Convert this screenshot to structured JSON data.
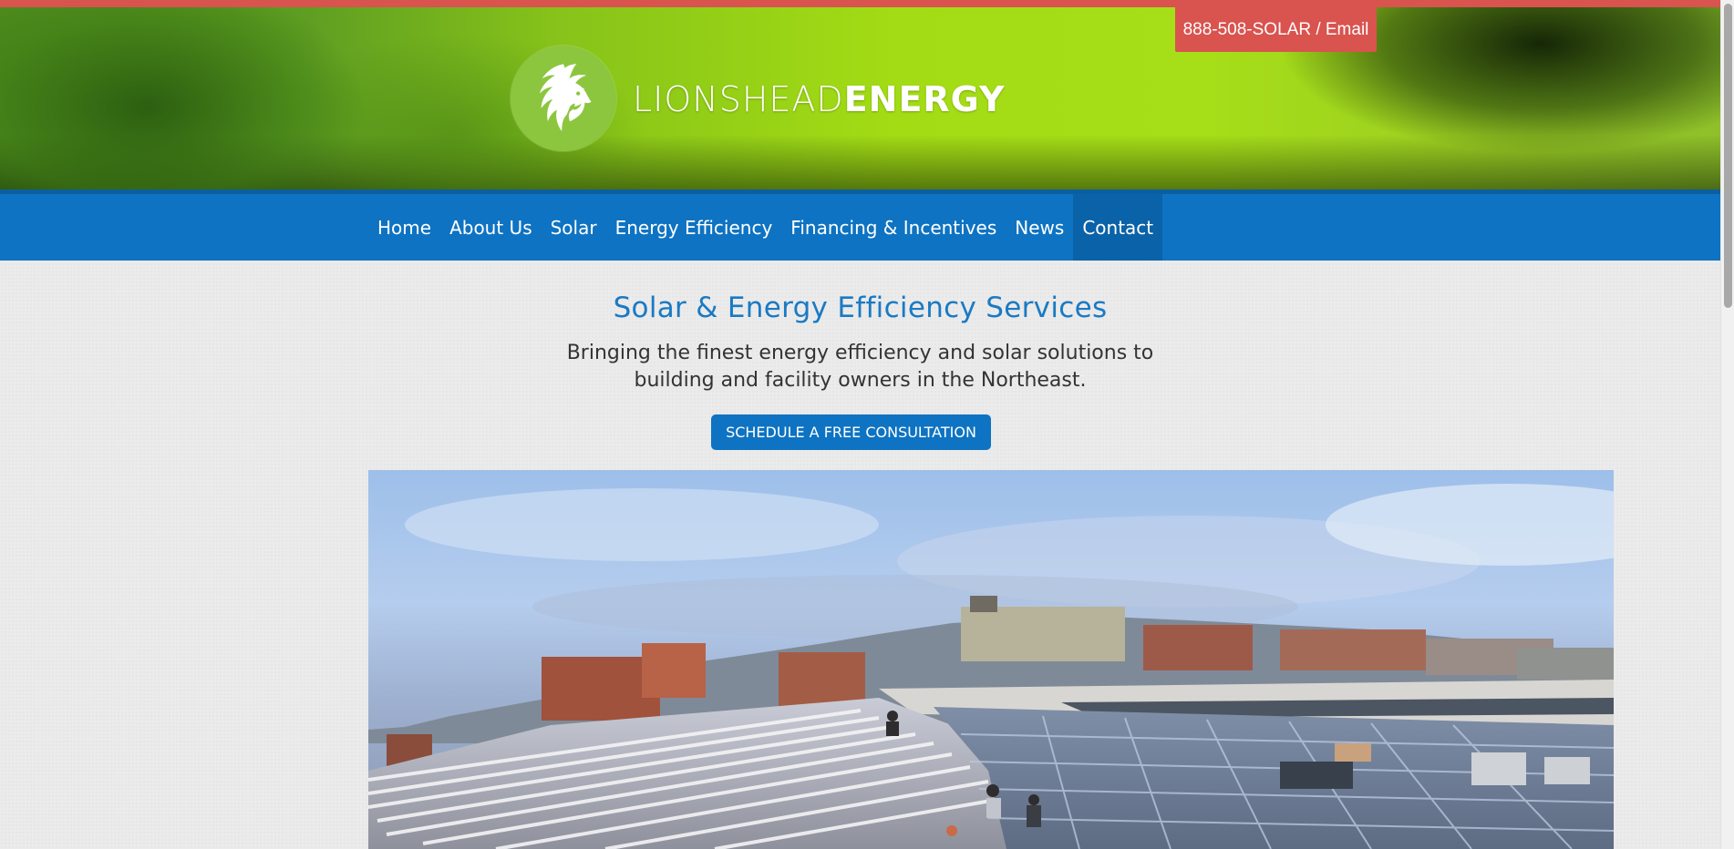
{
  "header": {
    "phone_email": "888-508-SOLAR / Email",
    "logo_light": "LIONSHEAD",
    "logo_bold": "ENERGY",
    "logo_icon": "lion-head-icon"
  },
  "nav": {
    "items": [
      {
        "label": "Home"
      },
      {
        "label": "About Us"
      },
      {
        "label": "Solar"
      },
      {
        "label": "Energy Efficiency"
      },
      {
        "label": "Financing & Incentives"
      },
      {
        "label": "News"
      },
      {
        "label": "Contact"
      }
    ],
    "active": "Contact"
  },
  "hero": {
    "title": "Solar & Energy Efficiency Services",
    "subtitle_line1": "Bringing the finest energy efficiency and solar solutions to",
    "subtitle_line2": "building and facility owners in the Northeast.",
    "cta": "SCHEDULE A FREE CONSULTATION"
  },
  "colors": {
    "accent_red": "#d9534f",
    "nav_blue": "#0e73c2",
    "title_blue": "#1a7ac4",
    "logo_green": "#8cc63f"
  }
}
